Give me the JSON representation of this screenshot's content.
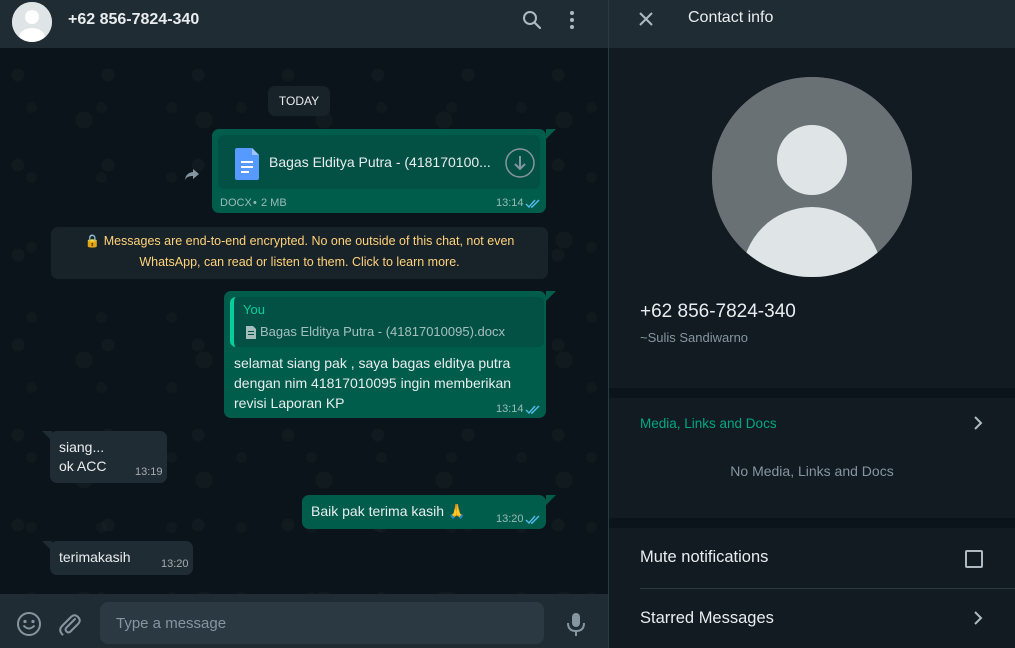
{
  "chat": {
    "title": "+62 856-7824-340",
    "date_chip": "TODAY",
    "document": {
      "name": "Bagas Eldit​ya Putra - (4181701​00...",
      "type": "DOCX",
      "size": "2 MB",
      "time": "13:14"
    },
    "encryption_line1": "Messages are end-to-end encrypted. No one outside of this chat, not even",
    "encryption_line2": "WhatsApp, can read or listen to them. Click to learn more.",
    "reply": {
      "quote_author": "You",
      "quote_text": "Bagas Eldit​ya Putra - (41817010095).docx",
      "line1": "selamat siang pak , saya bagas eldit​ya putra",
      "line2": "dengan nim 41817010095 ingin memberikan",
      "line3": "revisi Laporan KP",
      "time": "13:14"
    },
    "incoming1": {
      "line1": "siang...",
      "line2": "ok ACC",
      "time": "13:19"
    },
    "outgoing2": {
      "text": "Baik pak terima kasih 🙏",
      "time": "13:20"
    },
    "incoming2": {
      "text": "terimakasih",
      "time": "13:20"
    },
    "input_placeholder": "Type a message"
  },
  "contact_info": {
    "title": "Contact info",
    "phone": "+62 856-7824-340",
    "name": "~Sulis Sandiwarno",
    "media_title": "Media, Links and Docs",
    "media_empty": "No Media, Links and Docs",
    "mute_label": "Mute notifications",
    "starred_label": "Starred Messages"
  },
  "colors": {
    "outgoing_bubble": "#005c4b",
    "incoming_bubble": "#202c33",
    "accent": "#00a884",
    "encryption_text": "#ffd279"
  },
  "icons": [
    "avatar-icon",
    "search-icon",
    "menu-icon",
    "forward-icon",
    "doc-icon",
    "download-icon",
    "double-check-icon",
    "lock-icon",
    "emoji-icon",
    "attach-icon",
    "mic-icon",
    "close-icon",
    "chevron-right-icon",
    "checkbox-icon"
  ]
}
